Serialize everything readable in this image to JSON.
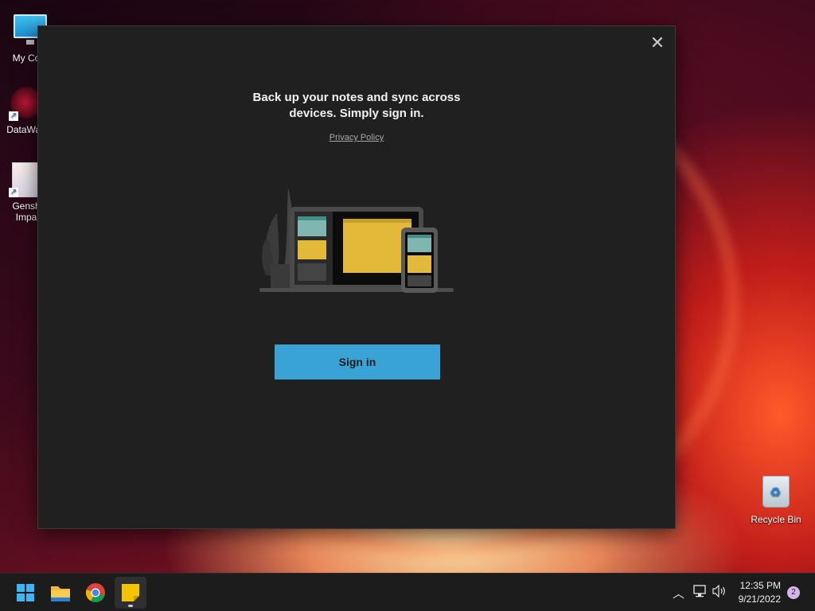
{
  "desktop": {
    "icons": [
      {
        "label": "My Com",
        "icon": "computer-icon"
      },
      {
        "label": "DataWag",
        "icon": "datawag-icon"
      },
      {
        "label": "Gensh\nImpa",
        "label_line1": "Gensh",
        "label_line2": "Impa",
        "icon": "genshin-impact-icon"
      },
      {
        "label": "Recycle Bin",
        "icon": "recycle-bin-icon"
      }
    ]
  },
  "dialog": {
    "headline_line1": "Back up your notes and sync across",
    "headline_line2": "devices. Simply sign in.",
    "privacy_link": "Privacy Policy",
    "signin_button": "Sign in",
    "close_icon": "close-icon"
  },
  "taskbar": {
    "apps": [
      {
        "name": "Start",
        "icon": "windows-start-icon"
      },
      {
        "name": "File Explorer",
        "icon": "folder-icon"
      },
      {
        "name": "Google Chrome",
        "icon": "chrome-icon"
      },
      {
        "name": "Sticky Notes",
        "icon": "sticky-notes-icon",
        "active": true
      }
    ],
    "tray": {
      "chevron_icon": "chevron-up-icon",
      "network_icon": "network-icon",
      "volume_icon": "volume-icon",
      "time": "12:35 PM",
      "date": "9/21/2022",
      "notification_count": "2"
    }
  },
  "colors": {
    "dialog_bg": "#202020",
    "accent": "#3aa3d6",
    "sticky_yellow": "#e3b93a",
    "sticky_teal": "#7fb6b0"
  }
}
